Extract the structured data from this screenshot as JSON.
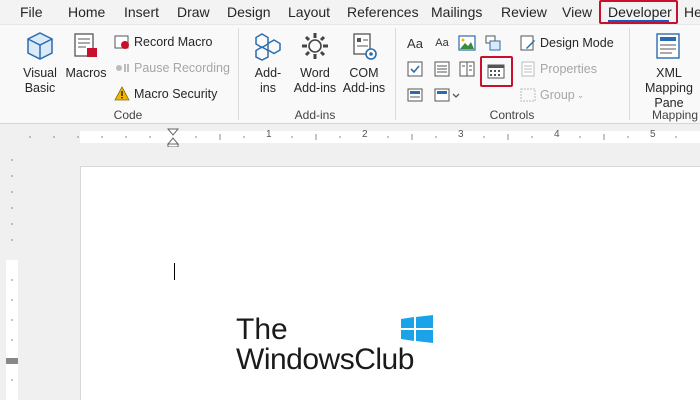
{
  "menu": {
    "tabs": [
      "File",
      "Home",
      "Insert",
      "Draw",
      "Design",
      "Layout",
      "References",
      "Mailings",
      "Review",
      "View",
      "Developer",
      "He"
    ],
    "active": "Developer"
  },
  "ribbon": {
    "code": {
      "label": "Code",
      "visual_basic": "Visual Basic",
      "macros": "Macros",
      "record_macro": "Record Macro",
      "pause_recording": "Pause Recording",
      "macro_security": "Macro Security"
    },
    "addins": {
      "label": "Add-ins",
      "addins_btn": "Add-ins",
      "word_addins": "Word Add-ins",
      "com_addins": "COM Add-ins"
    },
    "controls": {
      "label": "Controls",
      "rich_text": "Aa",
      "plain_text": "Aa",
      "design_mode": "Design Mode",
      "properties": "Properties",
      "group": "Group"
    },
    "mapping": {
      "label": "Mapping",
      "xml_mapping_pane": "XML Mapping Pane"
    }
  },
  "ruler": {
    "numbers": [
      "1",
      "2",
      "3",
      "4",
      "5"
    ]
  },
  "document": {
    "logo_line1": "The",
    "logo_line2": "WindowsClub"
  },
  "colors": {
    "accent_red": "#c8102e",
    "word_blue": "#185abd"
  }
}
